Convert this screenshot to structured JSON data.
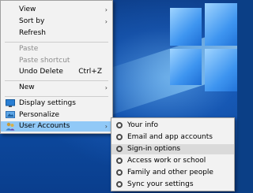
{
  "context_menu": {
    "items": [
      {
        "label": "View"
      },
      {
        "label": "Sort by"
      },
      {
        "label": "Refresh"
      },
      {
        "label": "Paste"
      },
      {
        "label": "Paste shortcut"
      },
      {
        "label": "Undo Delete",
        "shortcut": "Ctrl+Z"
      },
      {
        "label": "New"
      },
      {
        "label": "Display settings",
        "icon": "display-settings-icon"
      },
      {
        "label": "Personalize",
        "icon": "personalize-icon"
      },
      {
        "label": "User Accounts",
        "icon": "user-accounts-icon"
      }
    ]
  },
  "submenu": {
    "items": [
      {
        "label": "Your info"
      },
      {
        "label": "Email and app accounts"
      },
      {
        "label": "Sign-in options"
      },
      {
        "label": "Access work or school"
      },
      {
        "label": "Family and other people"
      },
      {
        "label": "Sync your settings"
      }
    ]
  },
  "colors": {
    "menu_background": "#f2f2f2",
    "menu_highlight": "#91c9f7",
    "submenu_highlight": "#dadada",
    "disabled_text": "#8c8c8c",
    "desktop_blue": "#0b3f86"
  }
}
